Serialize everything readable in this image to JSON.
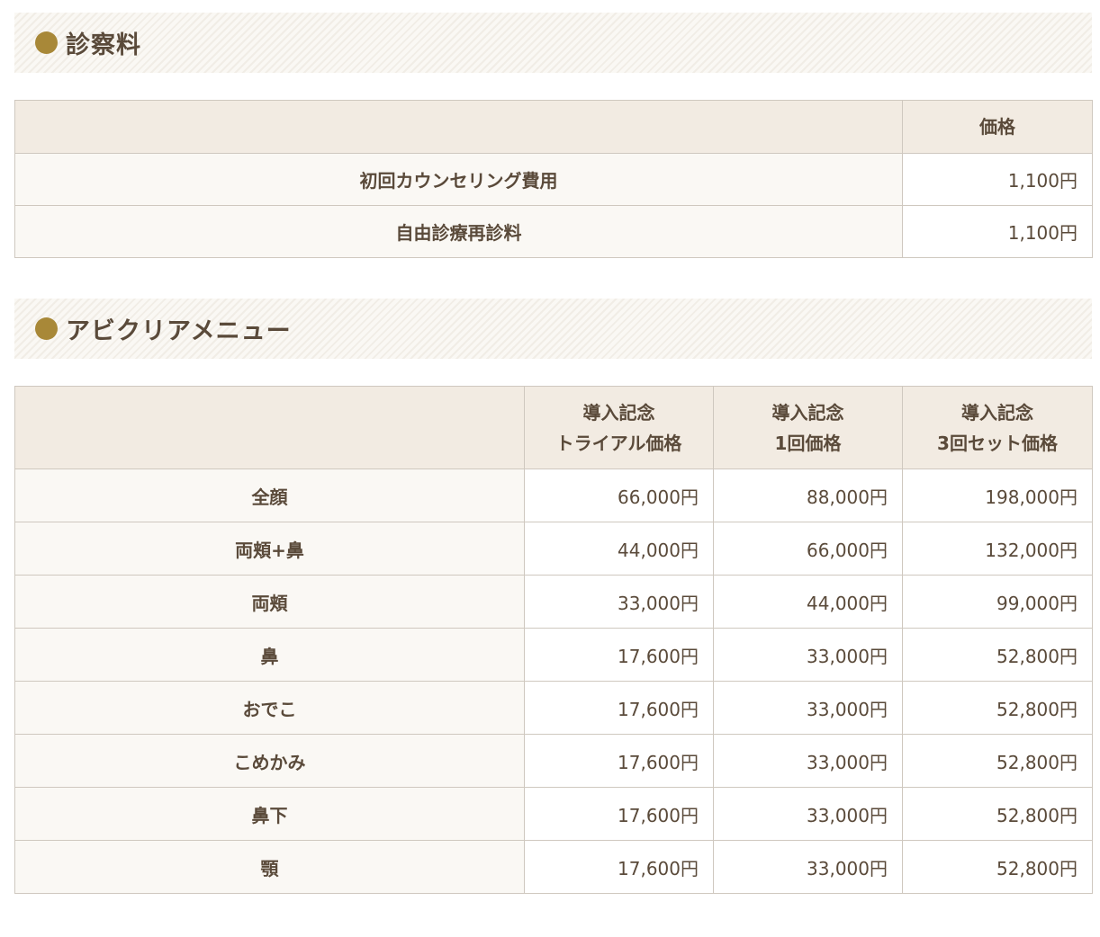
{
  "fees": {
    "heading": "診察料",
    "header": {
      "blank": "",
      "price": "価格"
    },
    "rows": [
      {
        "name": "初回カウンセリング費用",
        "price": "1,100円"
      },
      {
        "name": "自由診療再診料",
        "price": "1,100円"
      }
    ]
  },
  "menu": {
    "heading": "アビクリアメニュー",
    "header": {
      "blank": "",
      "col1_line1": "導入記念",
      "col1_line2": "トライアル価格",
      "col2_line1": "導入記念",
      "col2_line2": "1回価格",
      "col3_line1": "導入記念",
      "col3_line2": "3回セット価格"
    },
    "rows": [
      {
        "name": "全顔",
        "trial": "66,000円",
        "single": "88,000円",
        "set3": "198,000円"
      },
      {
        "name": "両頬+鼻",
        "trial": "44,000円",
        "single": "66,000円",
        "set3": "132,000円"
      },
      {
        "name": "両頬",
        "trial": "33,000円",
        "single": "44,000円",
        "set3": "99,000円"
      },
      {
        "name": "鼻",
        "trial": "17,600円",
        "single": "33,000円",
        "set3": "52,800円"
      },
      {
        "name": "おでこ",
        "trial": "17,600円",
        "single": "33,000円",
        "set3": "52,800円"
      },
      {
        "name": "こめかみ",
        "trial": "17,600円",
        "single": "33,000円",
        "set3": "52,800円"
      },
      {
        "name": "鼻下",
        "trial": "17,600円",
        "single": "33,000円",
        "set3": "52,800円"
      },
      {
        "name": "顎",
        "trial": "17,600円",
        "single": "33,000円",
        "set3": "52,800円"
      }
    ]
  },
  "colors": {
    "accent_dot": "#a88838",
    "header_bg": "#f2ebe2",
    "row_label_bg": "#faf8f4",
    "border": "#cfc8bf",
    "text": "#5a4a3a"
  }
}
